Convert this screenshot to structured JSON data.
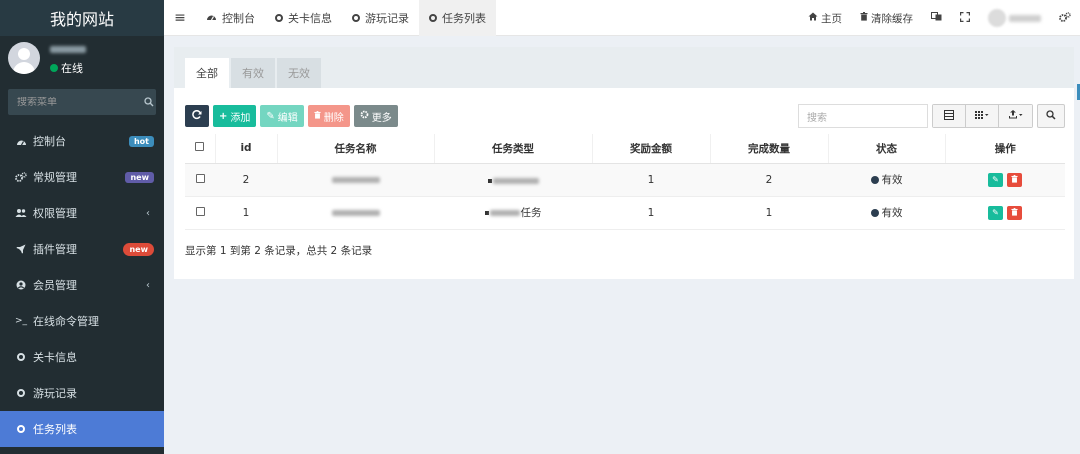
{
  "sidebar": {
    "site_name": "我的网站",
    "user": {
      "status": "在线"
    },
    "search_placeholder": "搜索菜单",
    "items": [
      {
        "label": "控制台",
        "icon": "dashboard-icon",
        "badge": "hot"
      },
      {
        "label": "常规管理",
        "icon": "cogs-icon",
        "badge": "new"
      },
      {
        "label": "权限管理",
        "icon": "group-icon",
        "has_arrow": true
      },
      {
        "label": "插件管理",
        "icon": "rocket-icon",
        "badge": "new"
      },
      {
        "label": "会员管理",
        "icon": "user-circle-icon",
        "has_arrow": true
      },
      {
        "label": "在线命令管理",
        "icon": "terminal-icon"
      },
      {
        "label": "关卡信息",
        "icon": "circle-icon"
      },
      {
        "label": "游玩记录",
        "icon": "circle-icon"
      },
      {
        "label": "任务列表",
        "icon": "circle-icon",
        "active": true
      }
    ]
  },
  "topbar": {
    "tabs": [
      {
        "label": "控制台",
        "icon": "dashboard-icon"
      },
      {
        "label": "关卡信息",
        "icon": "circle-icon"
      },
      {
        "label": "游玩记录",
        "icon": "circle-icon"
      },
      {
        "label": "任务列表",
        "icon": "circle-icon",
        "active": true
      }
    ],
    "home_label": "主页",
    "clear_cache_label": "清除缓存"
  },
  "content": {
    "filter_tabs": [
      "全部",
      "有效",
      "无效"
    ],
    "toolbar": {
      "add": "添加",
      "edit": "编辑",
      "delete": "删除",
      "more": "更多"
    },
    "search_placeholder": "搜索",
    "table": {
      "columns": [
        "id",
        "任务名称",
        "任务类型",
        "奖励金额",
        "完成数量",
        "状态",
        "操作"
      ],
      "rows": [
        {
          "id": "2",
          "type_suffix": "",
          "reward": "1",
          "count": "2",
          "status": "有效"
        },
        {
          "id": "1",
          "type_suffix": "任务",
          "reward": "1",
          "count": "1",
          "status": "有效"
        }
      ]
    },
    "summary": "显示第 1 到第 2 条记录，总共 2 条记录"
  },
  "colors": {
    "sidebar_bg": "#222d32",
    "active_menu": "#4d7bd6",
    "success": "#18bc9c",
    "danger": "#e74c3c"
  }
}
